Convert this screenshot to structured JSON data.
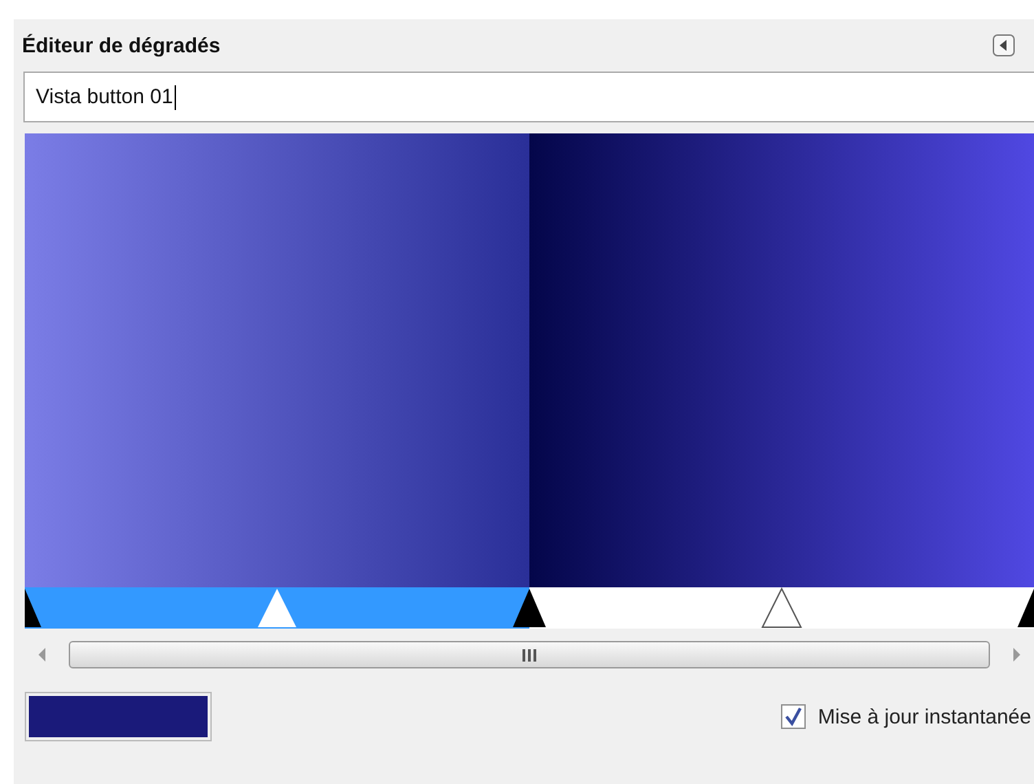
{
  "panel": {
    "title": "Éditeur de dégradés"
  },
  "name_field": {
    "value": "Vista button 01"
  },
  "segments": [
    {
      "selected": true
    },
    {
      "selected": false
    }
  ],
  "foreground_swatch": {
    "color": "#1a1a7a"
  },
  "instant_update": {
    "label": "Mise à jour instantanée",
    "checked": true
  }
}
